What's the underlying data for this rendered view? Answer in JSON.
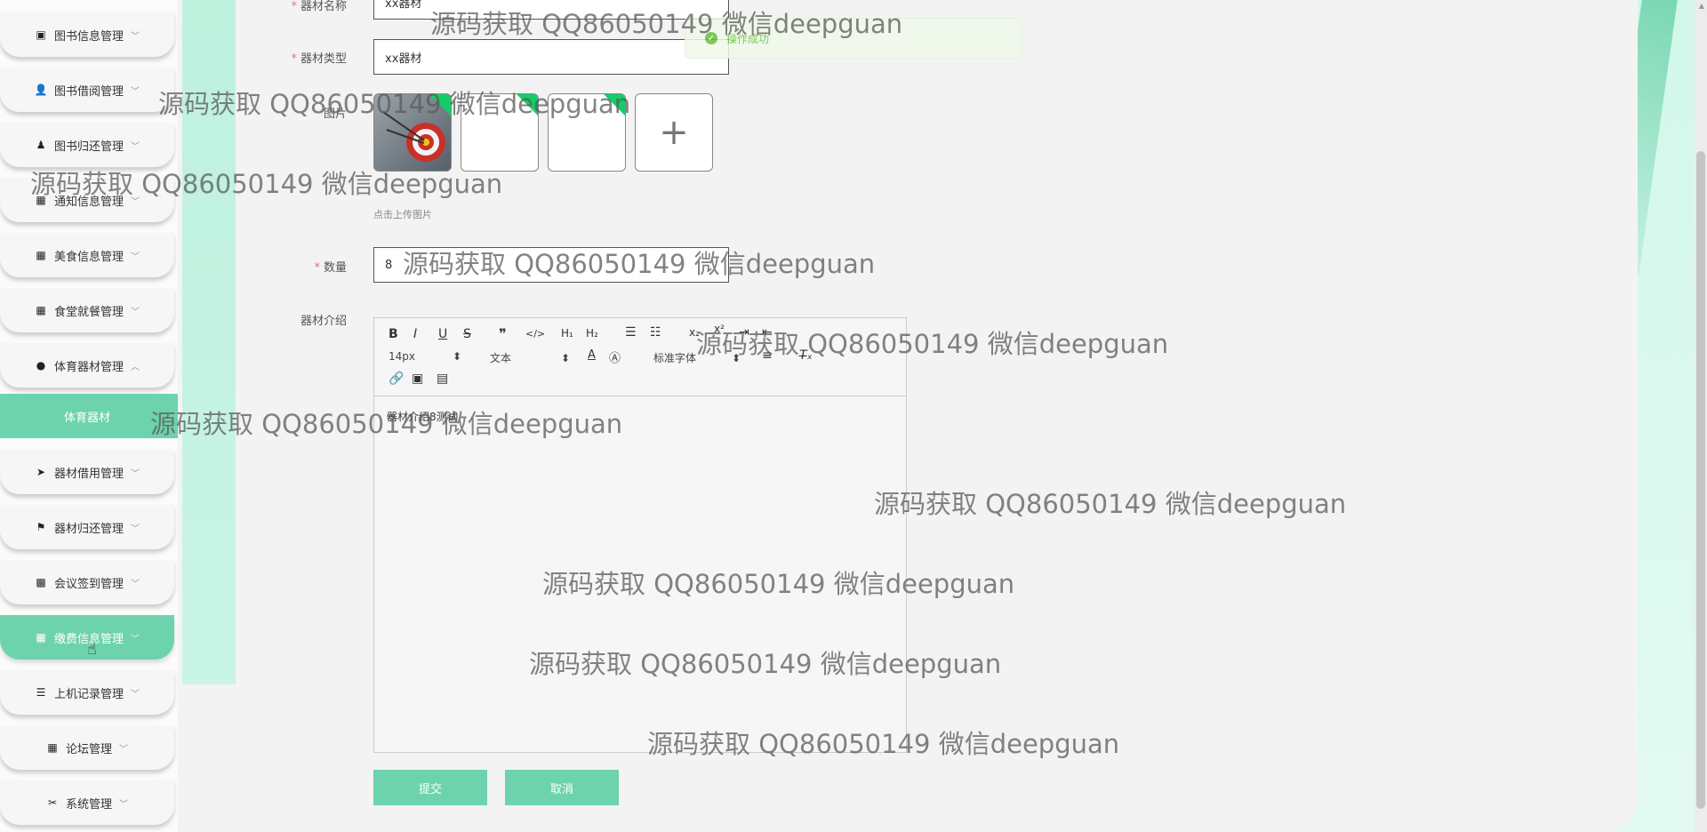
{
  "sidebar": {
    "items": [
      {
        "label": "图书信息管理",
        "icon": "book-icon"
      },
      {
        "label": "图书借阅管理",
        "icon": "user-icon"
      },
      {
        "label": "图书归还管理",
        "icon": "stamp-icon"
      },
      {
        "label": "通知信息管理",
        "icon": "grid-icon"
      },
      {
        "label": "美食信息管理",
        "icon": "grid-icon"
      },
      {
        "label": "食堂就餐管理",
        "icon": "grid-icon"
      },
      {
        "label": "体育器材管理",
        "icon": "bulb-icon"
      },
      {
        "label": "器材借用管理",
        "icon": "send-icon"
      },
      {
        "label": "器材归还管理",
        "icon": "flag-icon"
      },
      {
        "label": "会议签到管理",
        "icon": "grid9-icon"
      },
      {
        "label": "缴费信息管理",
        "icon": "grid-icon"
      },
      {
        "label": "上机记录管理",
        "icon": "list-icon"
      },
      {
        "label": "论坛管理",
        "icon": "grid-icon"
      },
      {
        "label": "系统管理",
        "icon": "tools-icon"
      }
    ],
    "submenu_label": "体育器材"
  },
  "form": {
    "name_label": "器材名称",
    "name_value": "xx器材",
    "type_label": "器材类型",
    "type_value": "xx器材",
    "image_label": "图片",
    "upload_hint": "点击上传图片",
    "quantity_label": "数量",
    "quantity_value": "8",
    "intro_label": "器材介绍",
    "intro_content": "器材介绍8测试",
    "submit_label": "提交",
    "cancel_label": "取消"
  },
  "editor_toolbar": {
    "font_size": "14px",
    "block_type": "文本",
    "font_family": "标准字体",
    "buttons": [
      "B",
      "I",
      "U",
      "S",
      "❞",
      "</>",
      "H₁",
      "H₂"
    ]
  },
  "toast": {
    "message": "操作成功"
  },
  "watermark": "源码获取 QQ86050149 微信deepguan",
  "colors": {
    "accent": "#6dd3ad",
    "success": "#67c23a",
    "required": "#f56c6c"
  }
}
